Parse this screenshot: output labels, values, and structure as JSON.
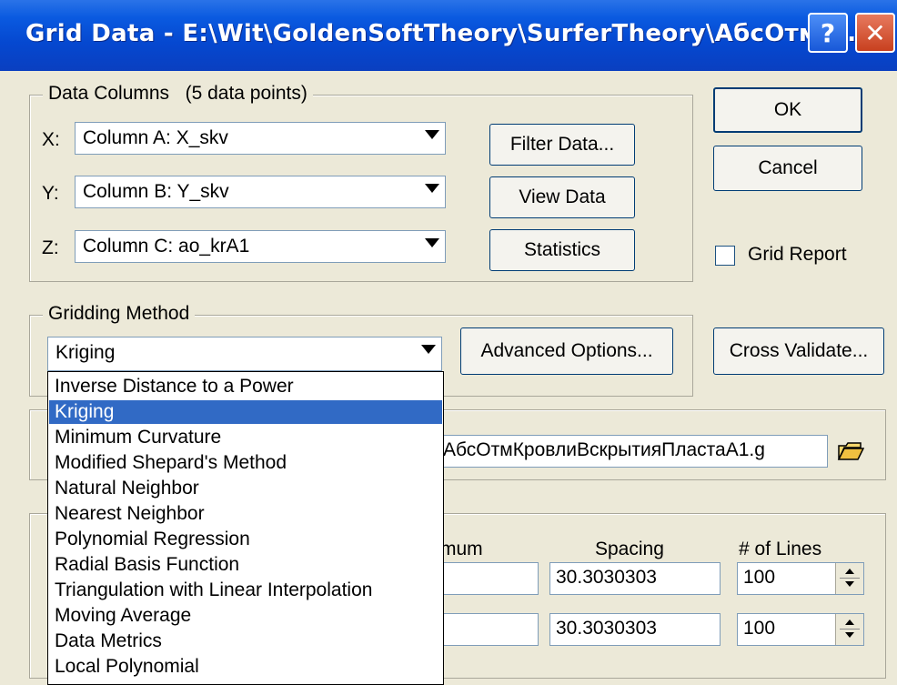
{
  "window": {
    "title": "Grid Data - E:\\Wit\\GoldenSoftTheory\\SurferTheory\\АбсОтмК..."
  },
  "data_columns": {
    "title": "Data Columns",
    "count": "(5 data points)",
    "x_label": "X:",
    "x_value": "Column A:  X_skv",
    "y_label": "Y:",
    "y_value": "Column B:  Y_skv",
    "z_label": "Z:",
    "z_value": "Column C:  ao_krA1",
    "filter_label": "Filter Data...",
    "view_label": "View Data",
    "stats_label": "Statistics"
  },
  "right_buttons": {
    "ok_label": "OK",
    "cancel_label": "Cancel",
    "grid_report_label": "Grid Report",
    "cross_label": "Cross Validate..."
  },
  "gridding": {
    "title": "Gridding Method",
    "value": "Kriging",
    "advanced_label": "Advanced Options...",
    "options": [
      "Inverse Distance to a Power",
      "Kriging",
      "Minimum Curvature",
      "Modified Shepard's Method",
      "Natural Neighbor",
      "Nearest Neighbor",
      "Polynomial Regression",
      "Radial Basis Function",
      "Triangulation with Linear Interpolation",
      "Moving Average",
      "Data Metrics",
      "Local Polynomial"
    ],
    "selected": "Kriging"
  },
  "output": {
    "file_text": "АбсОтмКровлиВскрытияПластаА1.g"
  },
  "geometry": {
    "max_header": "mum",
    "spacing_header": "Spacing",
    "lines_header": "# of Lines",
    "spacing_x": "30.3030303",
    "spacing_y": "30.3030303",
    "lines_x": "100",
    "lines_y": "100"
  },
  "colors": {
    "title_bar": "#0a5ae0",
    "selection": "#316ac5",
    "dialog_bg": "#ece9d8"
  }
}
